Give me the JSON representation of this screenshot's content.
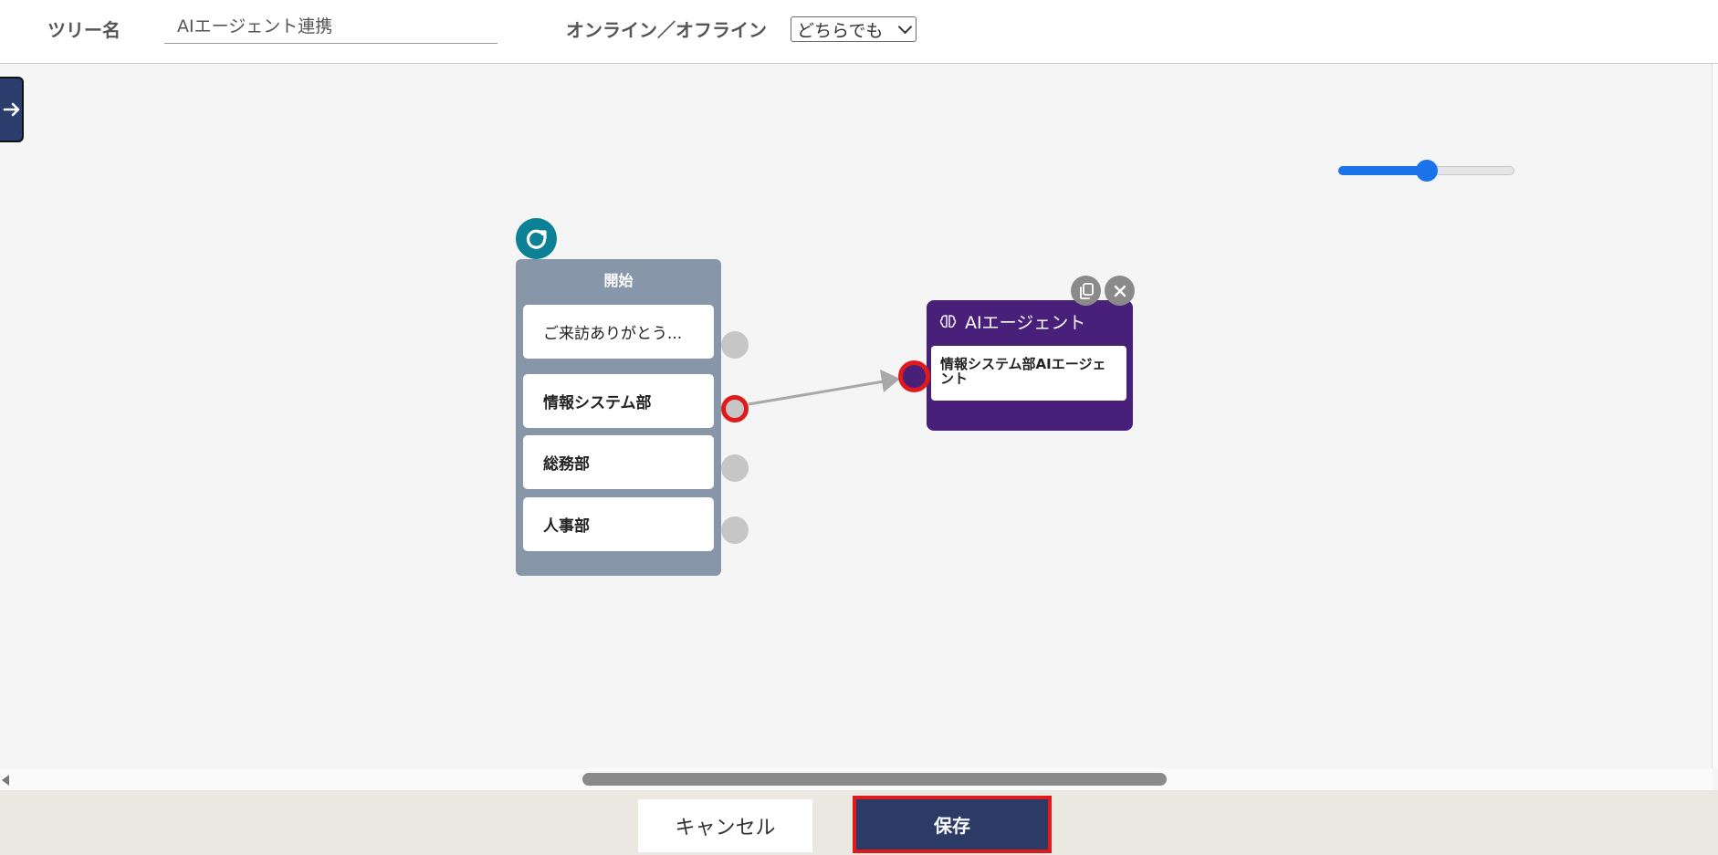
{
  "header": {
    "tree_name_label": "ツリー名",
    "tree_name_value": "AIエージェント連携",
    "online_label": "オンライン／オフライン",
    "online_select_value": "どちらでも"
  },
  "zoom_slider": {
    "value": 0.5
  },
  "start_node": {
    "title": "開始",
    "items": [
      {
        "label": "ご来訪ありがとう..."
      },
      {
        "label": "情報システム部"
      },
      {
        "label": "総務部"
      },
      {
        "label": "人事部"
      }
    ]
  },
  "ai_node": {
    "title": "AIエージェント",
    "body": "情報システム部AIエージェント",
    "icon": "brain-icon"
  },
  "footer": {
    "cancel_label": "キャンセル",
    "save_label": "保存"
  },
  "colors": {
    "primary": "#2b3b66",
    "ai_node": "#48207a",
    "start_node": "#8796a8",
    "highlight": "#e0191d",
    "slider": "#1a73e8"
  }
}
